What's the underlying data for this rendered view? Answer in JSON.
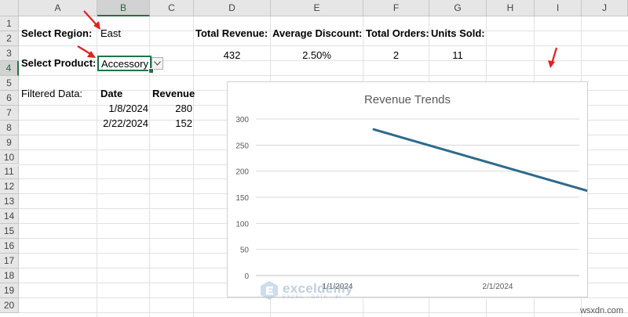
{
  "sheet": {
    "columns": [
      "A",
      "B",
      "C",
      "D",
      "E",
      "F",
      "G",
      "H",
      "I",
      "J"
    ],
    "rows": [
      "1",
      "2",
      "3",
      "4",
      "5",
      "6",
      "7",
      "8",
      "9",
      "10",
      "11",
      "12",
      "13",
      "14",
      "15",
      "16",
      "17",
      "18",
      "19",
      "20"
    ],
    "selected_column": "B",
    "selected_row": "4"
  },
  "cells": {
    "select_region_label": "Select Region:",
    "region_value": "East",
    "select_product_label": "Select Product:",
    "product_value": "Accessory",
    "summary_headers": [
      "Total Revenue:",
      "Average Discount:",
      "Total Orders:",
      "Units Sold:"
    ],
    "summary_values": [
      "432",
      "2.50%",
      "2",
      "11"
    ],
    "filtered_data_label": "Filtered Data:",
    "table_headers": [
      "Date",
      "Revenue"
    ],
    "table_rows": [
      {
        "date": "1/8/2024",
        "revenue": "280"
      },
      {
        "date": "2/22/2024",
        "revenue": "152"
      }
    ]
  },
  "chart_data": {
    "type": "line",
    "title": "Revenue Trends",
    "x": [
      "2024-01-08",
      "2024-02-22"
    ],
    "values": [
      280,
      152
    ],
    "x_tick_labels": [
      "1/1/2024",
      "2/1/2024"
    ],
    "y_ticks": [
      0,
      50,
      100,
      150,
      200,
      250,
      300
    ],
    "ylim": [
      0,
      300
    ],
    "grid": true,
    "line_color": "#2e6a8a"
  },
  "watermark": {
    "name": "exceldemy",
    "tagline": "EXCEL · DATA · BI"
  },
  "footer_credit": "wsxdn.com",
  "colors": {
    "accent": "#217346",
    "arrow": "#e02020"
  }
}
